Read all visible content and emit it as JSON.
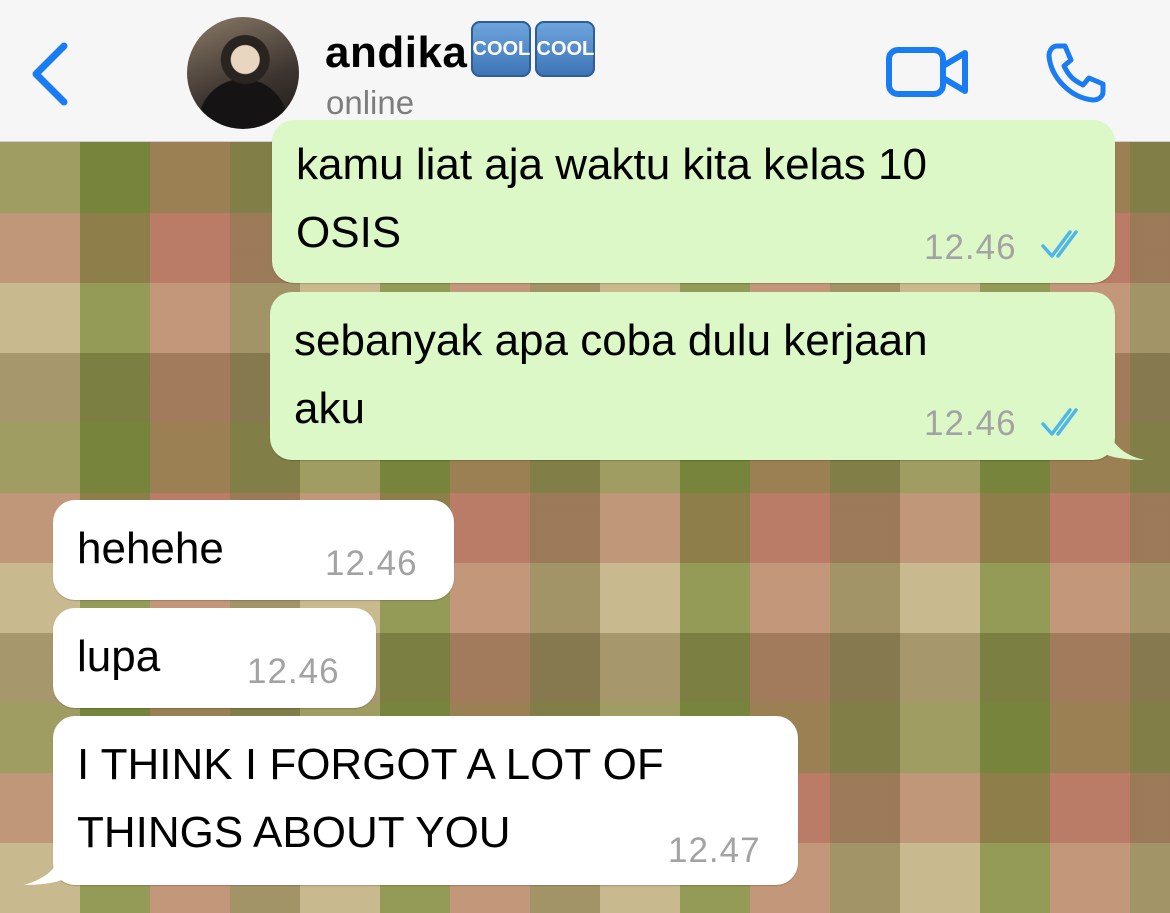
{
  "header": {
    "contact_name": "andika",
    "badge_1": "COOL",
    "badge_2": "COOL",
    "status": "online",
    "back_icon": "chevron-left-icon",
    "video_icon": "video-camera-icon",
    "call_icon": "phone-icon",
    "accent_color": "#1a7cf2"
  },
  "messages": [
    {
      "direction": "outgoing",
      "lines": [
        "kamu liat aja waktu kita kelas 10",
        "OSIS"
      ],
      "time": "12.46",
      "status": "read"
    },
    {
      "direction": "outgoing",
      "lines": [
        "sebanyak apa coba dulu kerjaan",
        "aku"
      ],
      "time": "12.46",
      "status": "read"
    },
    {
      "direction": "incoming",
      "lines": [
        "hehehe"
      ],
      "time": "12.46"
    },
    {
      "direction": "incoming",
      "lines": [
        "lupa"
      ],
      "time": "12.46"
    },
    {
      "direction": "incoming",
      "lines": [
        "I THINK I FORGOT A LOT OF",
        "THINGS ABOUT YOU"
      ],
      "time": "12.47"
    }
  ],
  "colors": {
    "outgoing_bubble": "#dcf8c6",
    "incoming_bubble": "#ffffff",
    "read_ticks": "#4fb6ec"
  }
}
